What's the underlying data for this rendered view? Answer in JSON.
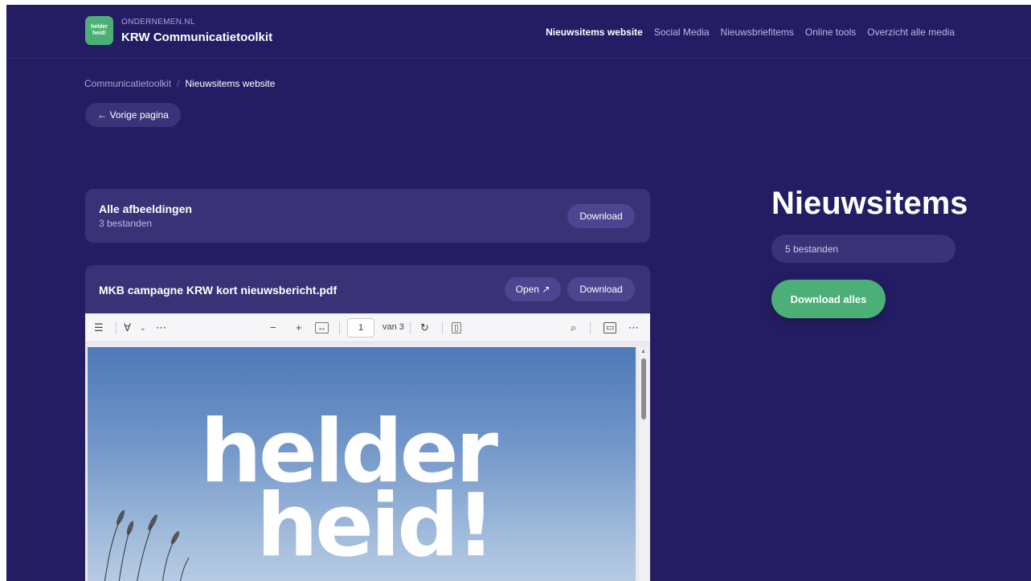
{
  "header": {
    "logo_text": "helder heid!",
    "brand_small": "ONDERNEMEN.NL",
    "brand_title": "KRW Communicatietoolkit",
    "nav": [
      {
        "label": "Nieuwsitems website",
        "active": true
      },
      {
        "label": "Social Media",
        "active": false
      },
      {
        "label": "Nieuwsbriefitems",
        "active": false
      },
      {
        "label": "Online tools",
        "active": false
      },
      {
        "label": "Overzicht alle media",
        "active": false
      }
    ]
  },
  "breadcrumb": {
    "root": "Communicatietoolkit",
    "separator": "/",
    "current": "Nieuwsitems website"
  },
  "back_button": "← Vorige pagina",
  "cards": {
    "images": {
      "title": "Alle afbeeldingen",
      "subtitle": "3 bestanden",
      "download_label": "Download"
    },
    "pdf": {
      "title": "MKB campagne KRW kort nieuwsbericht.pdf",
      "open_label": "Open ↗",
      "download_label": "Download"
    }
  },
  "pdf_viewer": {
    "page_current": "1",
    "page_total_label": "van 3",
    "page_headline_line1": "helder",
    "page_headline_line2": "heid!"
  },
  "side": {
    "title": "Nieuwsitems",
    "count_label": "5 bestanden",
    "download_all_label": "Download alles"
  },
  "colors": {
    "background": "#251d63",
    "card": "#3a3277",
    "accent_green": "#4caf77"
  }
}
